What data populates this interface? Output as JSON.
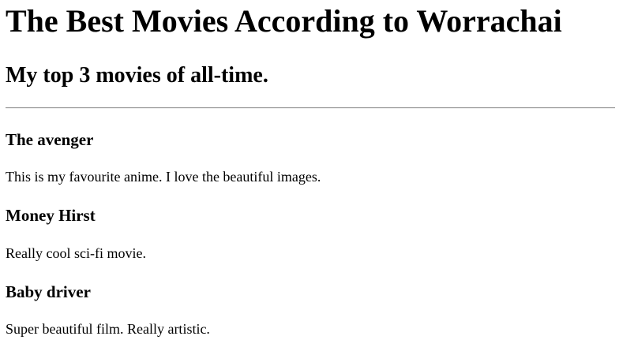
{
  "page": {
    "title": "The Best Movies According to Worrachai",
    "subtitle": "My top 3 movies of all-time."
  },
  "movies": [
    {
      "title": "The avenger",
      "description": "This is my favourite anime. I love the beautiful images."
    },
    {
      "title": "Money Hirst",
      "description": "Really cool sci-fi movie."
    },
    {
      "title": "Baby driver",
      "description": "Super beautiful film. Really artistic."
    }
  ]
}
